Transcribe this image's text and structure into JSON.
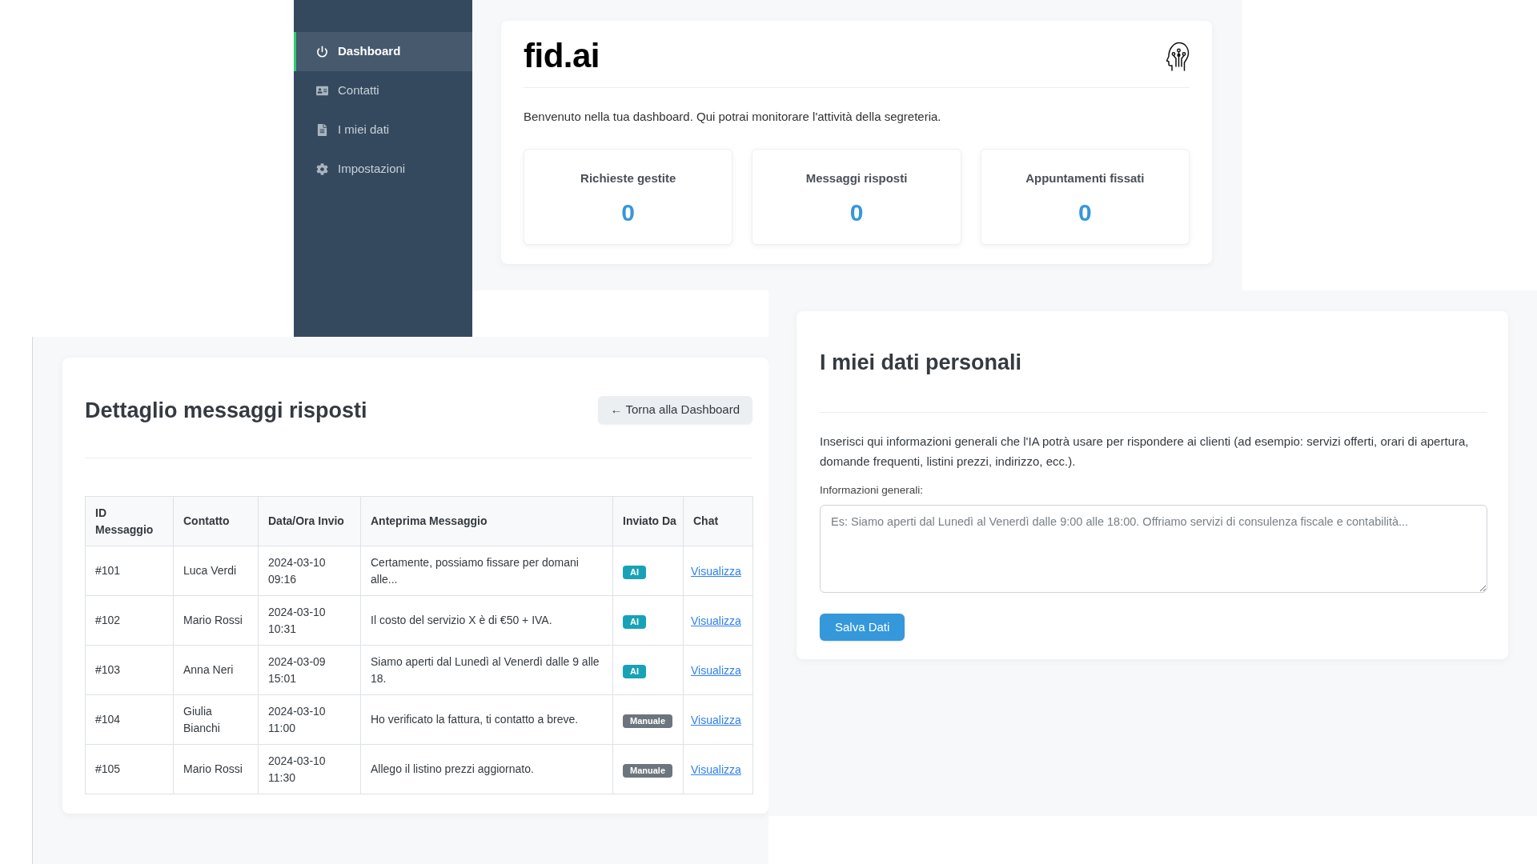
{
  "sidebar": {
    "items": [
      {
        "label": "Dashboard",
        "selected": true
      },
      {
        "label": "Contatti",
        "selected": false
      },
      {
        "label": "I miei dati",
        "selected": false
      },
      {
        "label": "Impostazioni",
        "selected": false
      }
    ]
  },
  "dashboard": {
    "logo": "fid.ai",
    "welcome": "Benvenuto nella tua dashboard. Qui potrai monitorare l'attività della segreteria.",
    "stats": [
      {
        "label": "Richieste gestite",
        "value": "0"
      },
      {
        "label": "Messaggi risposti",
        "value": "0"
      },
      {
        "label": "Appuntamenti fissati",
        "value": "0"
      }
    ]
  },
  "messages": {
    "title": "Dettaglio messaggi risposti",
    "back_button": "← Torna alla Dashboard",
    "table": {
      "columns": [
        "ID Messaggio",
        "Contatto",
        "Data/Ora Invio",
        "Anteprima Messaggio",
        "Inviato Da",
        "Chat"
      ],
      "rows": [
        {
          "id": "#101",
          "contact": "Luca Verdi",
          "sent_at": "2024-03-10 09:16",
          "preview": "Certamente, possiamo fissare per domani alle...",
          "sender": {
            "label": "AI",
            "color": "#17a2b8"
          },
          "chat_link": "Visualizza"
        },
        {
          "id": "#102",
          "contact": "Mario Rossi",
          "sent_at": "2024-03-10 10:31",
          "preview": "Il costo del servizio X è di €50 + IVA.",
          "sender": {
            "label": "AI",
            "color": "#17a2b8"
          },
          "chat_link": "Visualizza"
        },
        {
          "id": "#103",
          "contact": "Anna Neri",
          "sent_at": "2024-03-09 15:01",
          "preview": "Siamo aperti dal Lunedì al Venerdì dalle 9 alle 18.",
          "sender": {
            "label": "AI",
            "color": "#17a2b8"
          },
          "chat_link": "Visualizza"
        },
        {
          "id": "#104",
          "contact": "Giulia Bianchi",
          "sent_at": "2024-03-10 11:00",
          "preview": "Ho verificato la fattura, ti contatto a breve.",
          "sender": {
            "label": "Manuale",
            "color": "#6c757d"
          },
          "chat_link": "Visualizza"
        },
        {
          "id": "#105",
          "contact": "Mario Rossi",
          "sent_at": "2024-03-10 11:30",
          "preview": "Allego il listino prezzi aggiornato.",
          "sender": {
            "label": "Manuale",
            "color": "#6c757d"
          },
          "chat_link": "Visualizza"
        }
      ]
    }
  },
  "personal_data": {
    "title": "I miei dati personali",
    "description": "Inserisci qui informazioni generali che l'IA potrà usare per rispondere ai clienti (ad esempio: servizi offerti, orari di apertura, domande frequenti, listini prezzi, indirizzo, ecc.).",
    "field": {
      "label": "Informazioni generali:",
      "placeholder": "Es: Siamo aperti dal Lunedì al Venerdì dalle 9:00 alle 18:00. Offriamo servizi di consulenza fiscale e contabilità..."
    },
    "save_button": "Salva Dati"
  }
}
